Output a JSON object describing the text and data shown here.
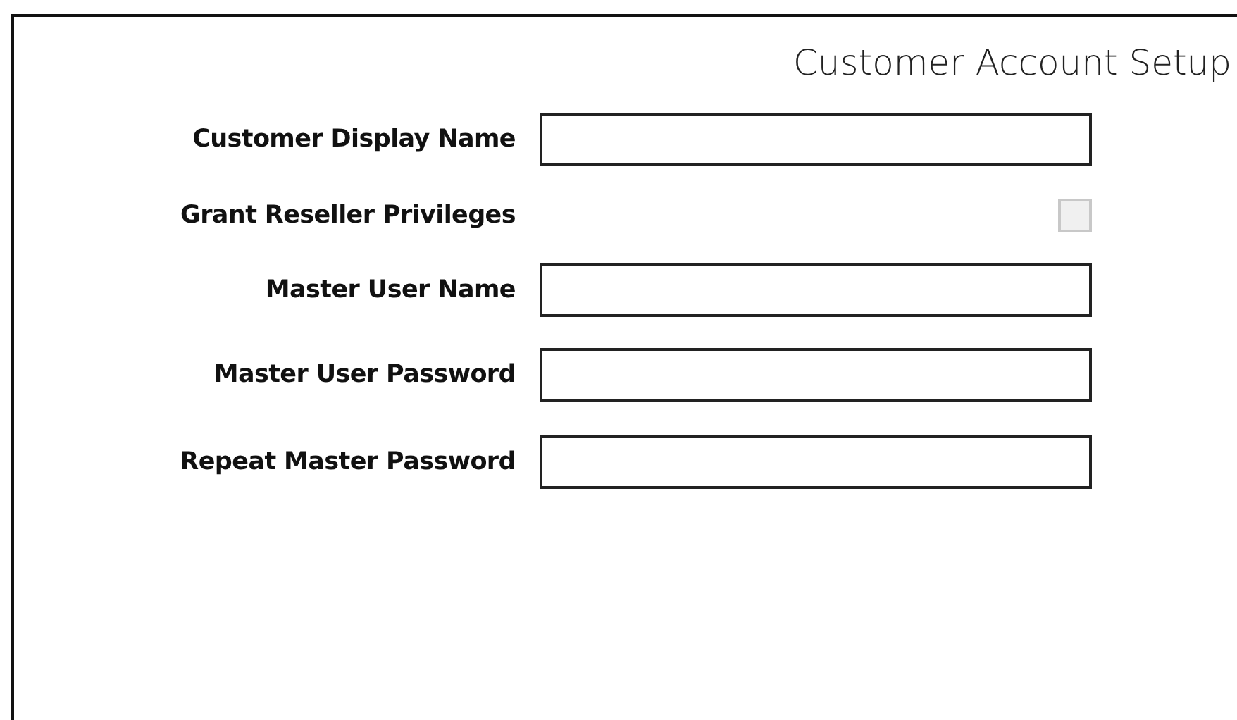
{
  "form": {
    "title": "Customer Account Setup",
    "fields": [
      {
        "kind": "text",
        "label": "Customer Display Name"
      },
      {
        "kind": "checkbox",
        "label": "Grant Reseller Privileges",
        "checked": false,
        "disabled": true
      },
      {
        "kind": "text",
        "label": "Master User Name"
      },
      {
        "kind": "password",
        "label": "Master User Password"
      },
      {
        "kind": "password",
        "label": "Repeat Master Password"
      }
    ]
  }
}
